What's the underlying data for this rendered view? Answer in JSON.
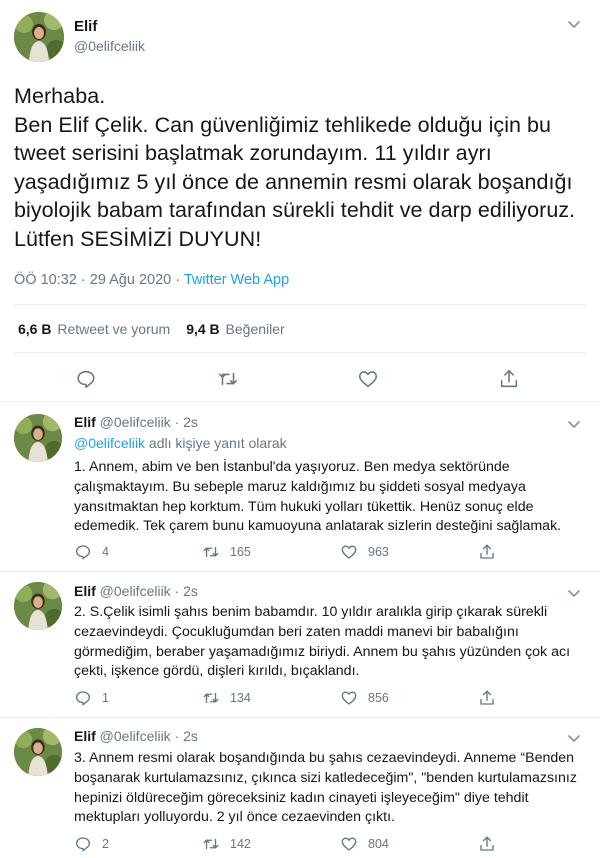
{
  "main_tweet": {
    "name": "Elif",
    "handle": "@0elifceliik",
    "text": "Merhaba.\nBen Elif Çelik. Can güvenliğimiz tehlikede olduğu için bu tweet serisini başlatmak zorundayım. 11 yıldır ayrı yaşadığımız 5 yıl önce de annemin resmi olarak boşandığı biyolojik babam tarafından sürekli tehdit ve darp ediliyoruz. Lütfen SESİMİZİ DUYUN!",
    "time": "ÖÖ 10:32 · 29 Ağu 2020 · ",
    "app": "Twitter Web App",
    "retweets_count": "6,6 B",
    "retweets_label": "Retweet ve yorum",
    "likes_count": "9,4 B",
    "likes_label": "Beğeniler"
  },
  "replies": [
    {
      "name": "Elif",
      "handle_time": "@0elifceliik · 2s",
      "context_mention": "@0elifceliik",
      "context_suffix": " adlı kişiye yanıt olarak",
      "text": "1. Annem, abim ve ben İstanbul'da yaşıyoruz. Ben medya sektöründe çalışmaktayım. Bu sebeple maruz kaldığımız bu şiddeti sosyal medyaya yansıtmaktan hep korktum. Tüm hukuki yolları tükettik. Henüz sonuç elde edemedik. Tek çarem bunu kamuoyuna anlatarak sizlerin desteğini sağlamak.",
      "replies": "4",
      "retweets": "165",
      "likes": "963"
    },
    {
      "name": "Elif",
      "handle_time": "@0elifceliik · 2s",
      "text": "2. S.Çelik isimli şahıs benim babamdır. 10 yıldır aralıkla girip çıkarak sürekli cezaevindeydi. Çocukluğumdan beri zaten maddi manevi bir babalığını görmediğim, beraber yaşamadığımız biriydi. Annem bu şahıs yüzünden çok acı çekti, işkence gördü, dişleri kırıldı, bıçaklandı.",
      "replies": "1",
      "retweets": "134",
      "likes": "856"
    },
    {
      "name": "Elif",
      "handle_time": "@0elifceliik · 2s",
      "text": "3. Annem resmi olarak boşandığında bu şahıs cezaevindeydi. Anneme “Benden boşanarak kurtulamazsınız, çıkınca sizi katledeceğim\", \"benden kurtulamazsınız hepinizi öldüreceğim göreceksiniz kadın cinayeti işleyeceğim\" diye tehdit mektupları yolluyordu. 2 yıl önce cezaevinden çıktı.",
      "replies": "2",
      "retweets": "142",
      "likes": "804"
    }
  ],
  "colors": {
    "accent": "#1da1f2",
    "secondary_text": "#657786",
    "border": "#e6ecf0"
  },
  "icons": [
    "chevron-down-icon",
    "reply-icon",
    "retweet-icon",
    "like-icon",
    "share-icon"
  ]
}
